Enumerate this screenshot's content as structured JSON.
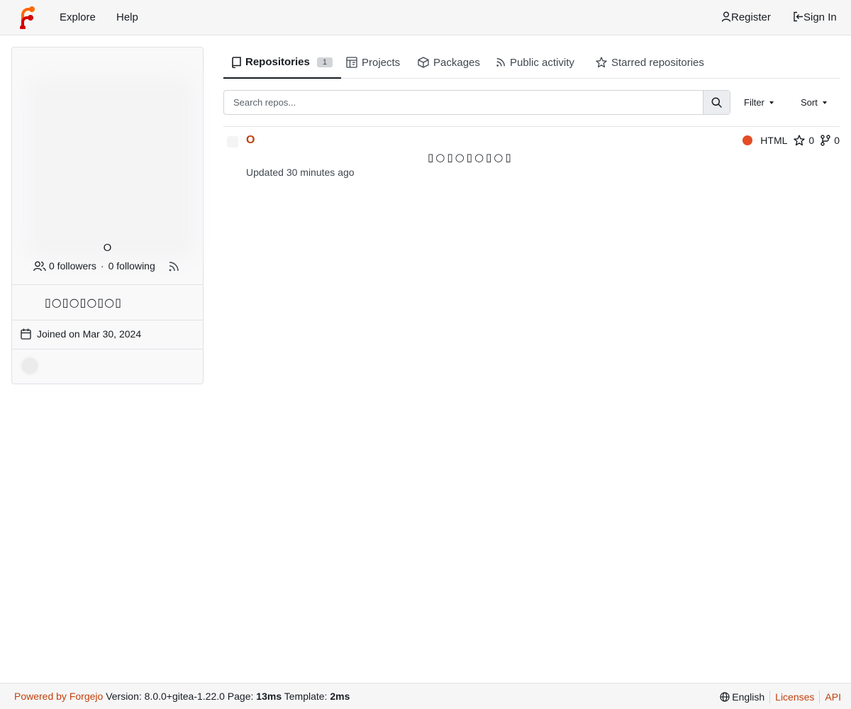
{
  "navbar": {
    "logo": "forgejo-logo",
    "explore_label": "Explore",
    "help_label": "Help",
    "register_label": "Register",
    "signin_label": "Sign In"
  },
  "profile": {
    "name": "O",
    "followers_text": "0 followers",
    "separator": "·",
    "following_text": "0 following",
    "bio": "▯○▯○▯○▯○▯",
    "joined_text": "Joined on Mar 30, 2024"
  },
  "tabs": [
    {
      "label": "Repositories",
      "count": "1",
      "icon": "repo-icon"
    },
    {
      "label": "Projects",
      "icon": "project-icon"
    },
    {
      "label": "Packages",
      "icon": "package-icon"
    },
    {
      "label": "Public activity",
      "icon": "rss-icon"
    },
    {
      "label": "Starred repositories",
      "icon": "star-icon"
    }
  ],
  "search": {
    "placeholder": "Search repos...",
    "filter_label": "Filter",
    "sort_label": "Sort"
  },
  "repos": [
    {
      "name": "O",
      "description": "▯○▯○▯○▯○▯",
      "updated": "Updated 30 minutes ago",
      "language": "HTML",
      "language_color": "#e34c26",
      "stars": "0",
      "forks": "0"
    }
  ],
  "footer": {
    "powered_by": "Powered by Forgejo",
    "version_text": "Version: 8.0.0+gitea-1.22.0 Page:",
    "page_time": "13ms",
    "template_label": "Template:",
    "template_time": "2ms",
    "language": "English",
    "licenses": "Licenses",
    "api": "API"
  },
  "colors": {
    "accent": "#c2410c",
    "navbar_bg": "#f6f6f7"
  }
}
